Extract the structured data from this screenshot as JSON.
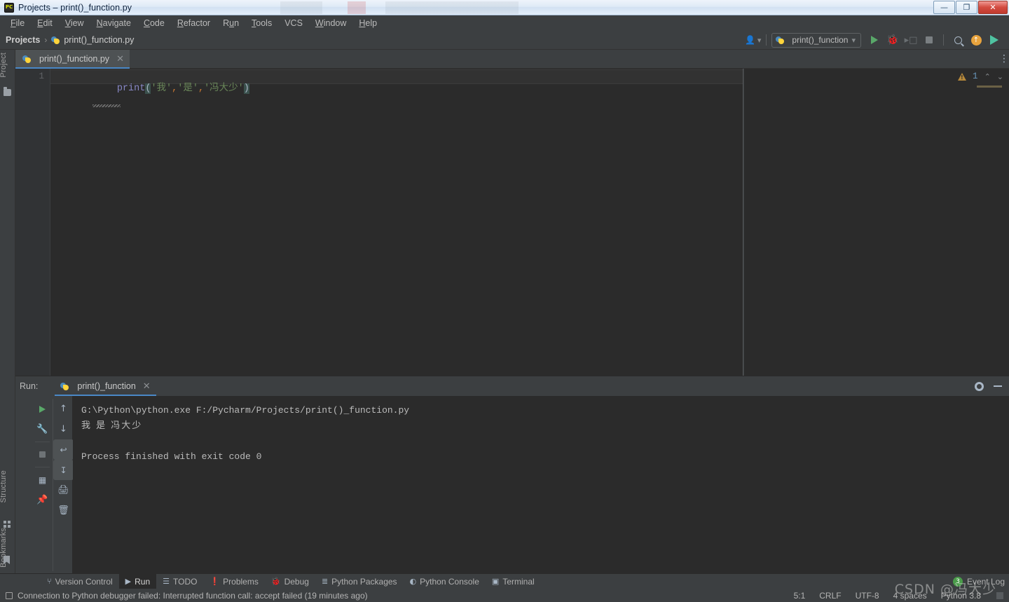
{
  "window": {
    "title": "Projects – print()_function.py",
    "app_icon": "pycharm-icon",
    "controls": {
      "minimize": "—",
      "restore": "❐",
      "close": "✕"
    }
  },
  "menubar": {
    "items": [
      {
        "label": "File",
        "mnemonic": "F"
      },
      {
        "label": "Edit",
        "mnemonic": "E"
      },
      {
        "label": "View",
        "mnemonic": "V"
      },
      {
        "label": "Navigate",
        "mnemonic": "N"
      },
      {
        "label": "Code",
        "mnemonic": "C"
      },
      {
        "label": "Refactor",
        "mnemonic": "R"
      },
      {
        "label": "Run",
        "mnemonic": "u"
      },
      {
        "label": "Tools",
        "mnemonic": "T"
      },
      {
        "label": "VCS",
        "mnemonic": ""
      },
      {
        "label": "Window",
        "mnemonic": "W"
      },
      {
        "label": "Help",
        "mnemonic": "H"
      }
    ]
  },
  "navbar": {
    "breadcrumb_root": "Projects",
    "breadcrumb_separator": "›",
    "breadcrumb_file": "print()_function.py",
    "run_configuration": "print()_function",
    "dropdown_arrow": "▾",
    "avatar_icon": "user-avatar-icon",
    "avatar_arrow": "▾",
    "buttons": [
      {
        "name": "run-button",
        "icon": "play-icon"
      },
      {
        "name": "debug-button",
        "icon": "bug-icon"
      },
      {
        "name": "coverage-button",
        "icon": "run-coverage-icon"
      },
      {
        "name": "stop-button",
        "icon": "stop-icon"
      },
      {
        "name": "search-button",
        "icon": "search-icon"
      },
      {
        "name": "update-button",
        "icon": "update-arrow-icon"
      },
      {
        "name": "run-anything",
        "icon": "run-external-icon"
      }
    ]
  },
  "left_rail": {
    "top": [
      {
        "label": "Project",
        "icon": "folder-icon"
      }
    ],
    "bottom": [
      {
        "label": "Structure",
        "icon": "structure-icon"
      },
      {
        "label": "Bookmarks",
        "icon": "bookmark-icon"
      }
    ]
  },
  "editor": {
    "tab": {
      "label": "print()_function.py",
      "icon": "python-file-icon",
      "close": "✕"
    },
    "more_icon": "⋮",
    "line_number": "1",
    "code_tokens": [
      {
        "text": "print",
        "type": "function"
      },
      {
        "text": "(",
        "type": "bracket-match"
      },
      {
        "text": "'我'",
        "type": "string"
      },
      {
        "text": ",",
        "type": "comma"
      },
      {
        "text": "'是'",
        "type": "string"
      },
      {
        "text": ",",
        "type": "comma"
      },
      {
        "text": "'冯大少'",
        "type": "string"
      },
      {
        "text": ")",
        "type": "bracket-match"
      }
    ],
    "code_plain": "print('我','是','冯大少')",
    "inspection": {
      "icon": "warning-triangle-icon",
      "count": "1",
      "up": "⌃",
      "down": "⌄"
    }
  },
  "run_panel": {
    "title": "Run:",
    "tab": {
      "label": "print()_function",
      "icon": "python-icon",
      "close": "✕"
    },
    "header_buttons": [
      {
        "name": "settings-button",
        "icon": "gear-icon"
      },
      {
        "name": "hide-button",
        "icon": "minimize-icon"
      }
    ],
    "toolbar_left": [
      {
        "name": "rerun-button",
        "icon": "play-icon"
      },
      {
        "name": "edit-config-button",
        "icon": "wrench-icon"
      },
      {
        "name": "stop-button",
        "icon": "stop-icon"
      },
      {
        "name": "layout-button",
        "icon": "layout-icon"
      },
      {
        "name": "pin-tab-button",
        "icon": "pin-icon"
      }
    ],
    "toolbar_right": [
      {
        "name": "up-button",
        "icon": "arrow-up-icon"
      },
      {
        "name": "down-button",
        "icon": "arrow-down-icon"
      },
      {
        "name": "soft-wrap-button",
        "icon": "soft-wrap-icon"
      },
      {
        "name": "scroll-to-end-button",
        "icon": "scroll-end-icon"
      },
      {
        "name": "print-button",
        "icon": "printer-icon"
      },
      {
        "name": "clear-all-button",
        "icon": "trash-icon"
      }
    ],
    "console_lines": [
      {
        "text": "G:\\Python\\python.exe F:/Pycharm/Projects/print()_function.py",
        "cjk": false
      },
      {
        "text": "我 是 冯大少",
        "cjk": true
      },
      {
        "text": "",
        "cjk": false
      },
      {
        "text": "Process finished with exit code 0",
        "cjk": false
      }
    ]
  },
  "bottom_bar": {
    "items": [
      {
        "label": "Version Control",
        "icon": "branch-icon",
        "active": false
      },
      {
        "label": "Run",
        "icon": "play-icon",
        "active": true
      },
      {
        "label": "TODO",
        "icon": "list-icon",
        "active": false
      },
      {
        "label": "Problems",
        "icon": "problems-icon",
        "active": false
      },
      {
        "label": "Debug",
        "icon": "bug-icon",
        "active": false
      },
      {
        "label": "Python Packages",
        "icon": "packages-icon",
        "active": false
      },
      {
        "label": "Python Console",
        "icon": "python-icon",
        "active": false
      },
      {
        "label": "Terminal",
        "icon": "terminal-icon",
        "active": false
      }
    ],
    "event_log": {
      "label": "Event Log",
      "badge": "3",
      "icon": "event-log-icon"
    }
  },
  "status_bar": {
    "message": "Connection to Python debugger failed: Interrupted function call: accept failed (19 minutes ago)",
    "message_icon": "message-square-icon",
    "cells": [
      {
        "name": "caret-position",
        "value": "5:1"
      },
      {
        "name": "line-separator",
        "value": "CRLF"
      },
      {
        "name": "file-encoding",
        "value": "UTF-8"
      },
      {
        "name": "indent-setting",
        "value": "4 spaces"
      },
      {
        "name": "python-interpreter",
        "value": "Python 3.8"
      }
    ]
  },
  "watermark": {
    "text": "CSDN @冯大少"
  },
  "colors": {
    "accent_blue": "#4a88c7",
    "editor_bg": "#2b2b2b",
    "chrome_bg": "#3c3f41",
    "string_green": "#6a8759",
    "function_purple": "#8888c6",
    "comma_orange": "#cc7832",
    "run_green": "#59a869",
    "warn_amber": "#b5883a",
    "badge_green": "#4a9c4a"
  }
}
